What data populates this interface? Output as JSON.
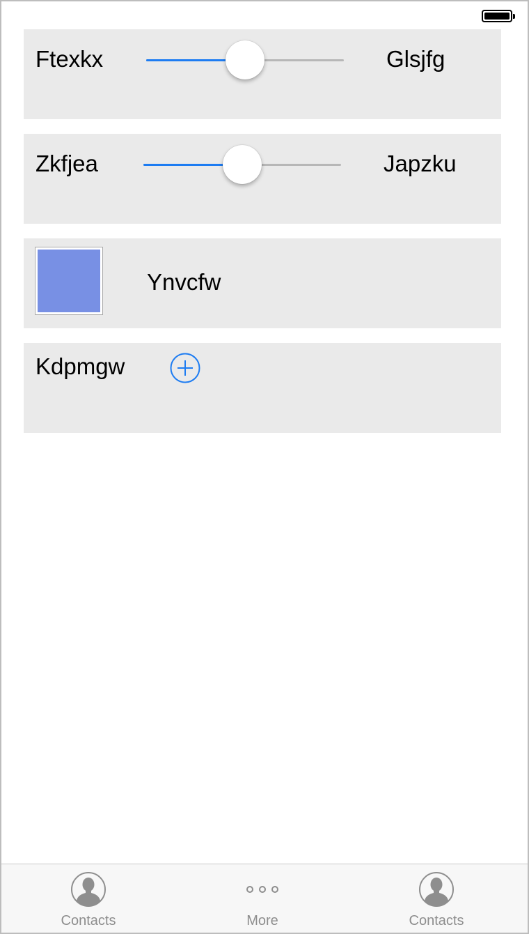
{
  "rows": [
    {
      "type": "slider",
      "left_label": "Ftexkx",
      "right_label": "Glsjfg",
      "value_fraction": 0.5
    },
    {
      "type": "slider",
      "left_label": "Zkfjea",
      "right_label": "Japzku",
      "value_fraction": 0.5
    },
    {
      "type": "color",
      "label": "Ynvcfw",
      "color": "#7890e4"
    },
    {
      "type": "add",
      "label": "Kdpmgw"
    }
  ],
  "tabbar": {
    "tabs": [
      {
        "label": "Contacts",
        "icon": "contact-icon"
      },
      {
        "label": "More",
        "icon": "more-icon"
      },
      {
        "label": "Contacts",
        "icon": "contact-icon"
      }
    ]
  },
  "colors": {
    "accent": "#1d7cf2",
    "card": "#eaeaea",
    "tab_gray": "#8e8e8e"
  }
}
